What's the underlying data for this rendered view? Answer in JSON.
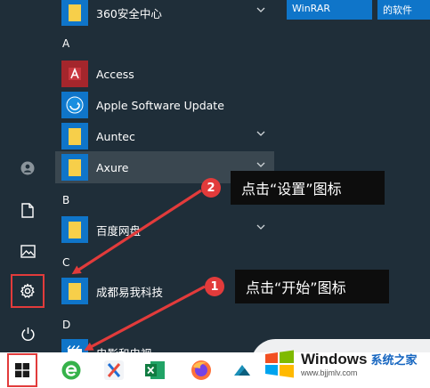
{
  "start_menu": {
    "rail": {
      "user": "user-icon",
      "documents": "document-icon",
      "pictures": "pictures-icon",
      "settings": "gear-icon",
      "power": "power-icon"
    },
    "apps": [
      {
        "label": "360安全中心",
        "icon": "folder-icon",
        "expandable": true
      },
      {
        "group": "A"
      },
      {
        "label": "Access",
        "icon": "access-icon"
      },
      {
        "label": "Apple Software Update",
        "icon": "apple-update-icon"
      },
      {
        "label": "Auntec",
        "icon": "folder-icon",
        "expandable": true
      },
      {
        "label": "Axure",
        "icon": "folder-icon",
        "expandable": true,
        "highlighted": true
      },
      {
        "group": "B"
      },
      {
        "label": "百度网盘",
        "icon": "folder-icon",
        "expandable": true
      },
      {
        "group": "C"
      },
      {
        "label": "成都易我科技",
        "icon": "folder-icon",
        "expandable": true
      },
      {
        "group": "D"
      },
      {
        "label": "电影和电视",
        "icon": "movies-tv-icon"
      }
    ],
    "tiles": [
      {
        "label": "WinRAR"
      },
      {
        "label": "的软件"
      }
    ]
  },
  "taskbar": {
    "icons": [
      "windows-start-icon",
      "ie-icon",
      "xmind-icon",
      "excel-icon",
      "firefox-icon",
      "app-icon"
    ]
  },
  "callouts": [
    {
      "number": "2",
      "text": "点击“设置”图标"
    },
    {
      "number": "1",
      "text": "点击“开始”图标"
    }
  ],
  "watermark": {
    "brand": "Windows",
    "site": "系统之家",
    "url": "www.bjjmlv.com"
  },
  "colors": {
    "menu_bg": "#1f2e39",
    "accent": "#0f75c9",
    "highlight_red": "#e23b3b",
    "callout_bg": "#0d0d0d"
  }
}
